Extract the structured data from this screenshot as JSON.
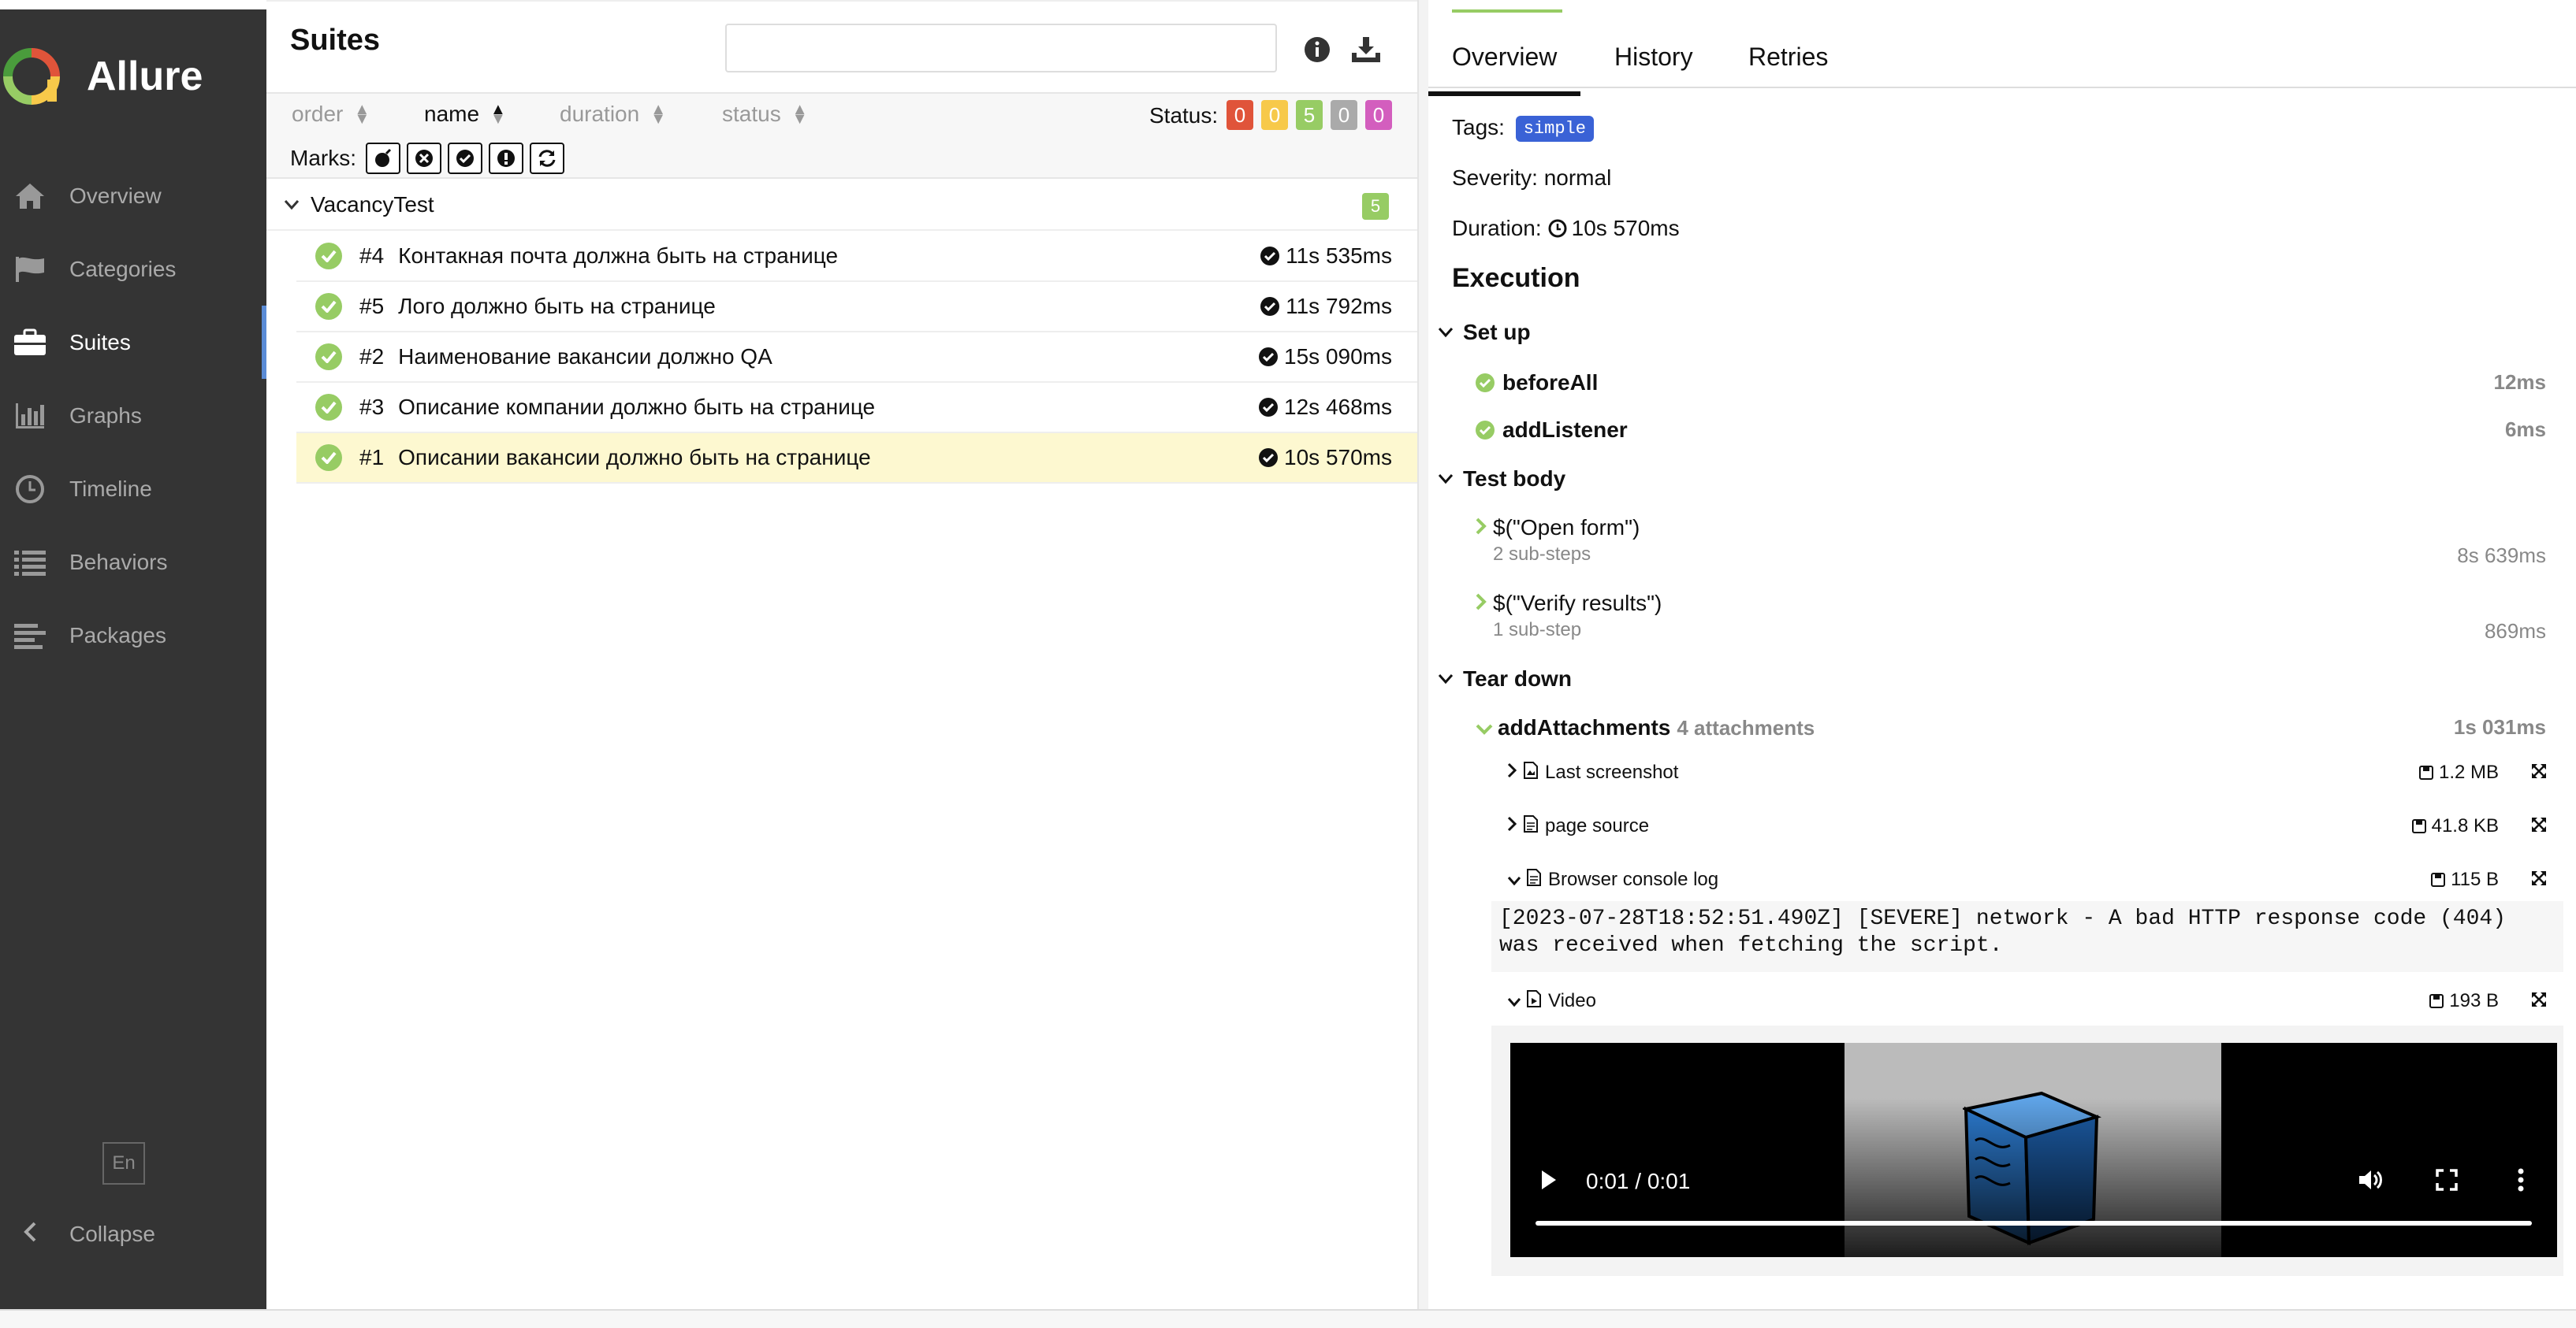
{
  "app": {
    "title": "Allure"
  },
  "sidebar": {
    "items": [
      {
        "label": "Overview",
        "icon": "home-icon"
      },
      {
        "label": "Categories",
        "icon": "flag-icon"
      },
      {
        "label": "Suites",
        "icon": "briefcase-icon",
        "active": true
      },
      {
        "label": "Graphs",
        "icon": "bar-chart-icon"
      },
      {
        "label": "Timeline",
        "icon": "clock-icon"
      },
      {
        "label": "Behaviors",
        "icon": "list-icon"
      },
      {
        "label": "Packages",
        "icon": "align-left-icon"
      }
    ],
    "language": "En",
    "collapse_label": "Collapse"
  },
  "suites": {
    "title": "Suites",
    "search_value": "",
    "sort": {
      "order": "order",
      "name": "name",
      "duration": "duration",
      "status": "status"
    },
    "status_label": "Status:",
    "status_counts": [
      {
        "value": "0",
        "color": "#e0543a"
      },
      {
        "value": "0",
        "color": "#f7c94a"
      },
      {
        "value": "5",
        "color": "#97cc64"
      },
      {
        "value": "0",
        "color": "#aaaaaa"
      },
      {
        "value": "0",
        "color": "#d35ebe"
      }
    ],
    "marks_label": "Marks:",
    "group": {
      "name": "VacancyTest",
      "count": "5"
    },
    "rows": [
      {
        "num": "#4",
        "name": "Контакная почта должна быть на странице",
        "duration": "11s 535ms"
      },
      {
        "num": "#5",
        "name": "Лого должно быть на странице",
        "duration": "11s 792ms"
      },
      {
        "num": "#2",
        "name": "Наименование вакансии должно QA",
        "duration": "15s 090ms"
      },
      {
        "num": "#3",
        "name": "Описание компании должно быть на странице",
        "duration": "12s 468ms"
      },
      {
        "num": "#1",
        "name": "Описании вакансии должно быть на странице",
        "duration": "10s 570ms"
      }
    ]
  },
  "detail": {
    "tabs": [
      "Overview",
      "History",
      "Retries"
    ],
    "tags_label": "Tags:",
    "tag": "simple",
    "severity": "Severity: normal",
    "duration_label": "Duration:",
    "duration_value": "10s 570ms",
    "execution_title": "Execution",
    "setup": {
      "label": "Set up",
      "steps": [
        {
          "name": "beforeAll",
          "time": "12ms"
        },
        {
          "name": "addListener",
          "time": "6ms"
        }
      ]
    },
    "body": {
      "label": "Test body",
      "steps": [
        {
          "name": "$(\"Open form\")",
          "sub": "2 sub-steps",
          "time": "8s 639ms"
        },
        {
          "name": "$(\"Verify results\")",
          "sub": "1 sub-step",
          "time": "869ms"
        }
      ]
    },
    "teardown": {
      "label": "Tear down",
      "step": {
        "name": "addAttachments",
        "note": "4 attachments",
        "time": "1s 031ms"
      },
      "attachments": [
        {
          "name": "Last screenshot",
          "size": "1.2 MB"
        },
        {
          "name": "page source",
          "size": "41.8 KB"
        },
        {
          "name": "Browser console log",
          "size": "115 B"
        },
        {
          "name": "Video",
          "size": "193 B"
        }
      ],
      "console_text": "[2023-07-28T18:52:51.490Z] [SEVERE] network - A bad HTTP response code (404) was received when fetching the script.",
      "video_time": "0:01 / 0:01",
      "video_progress": 1.0
    }
  }
}
